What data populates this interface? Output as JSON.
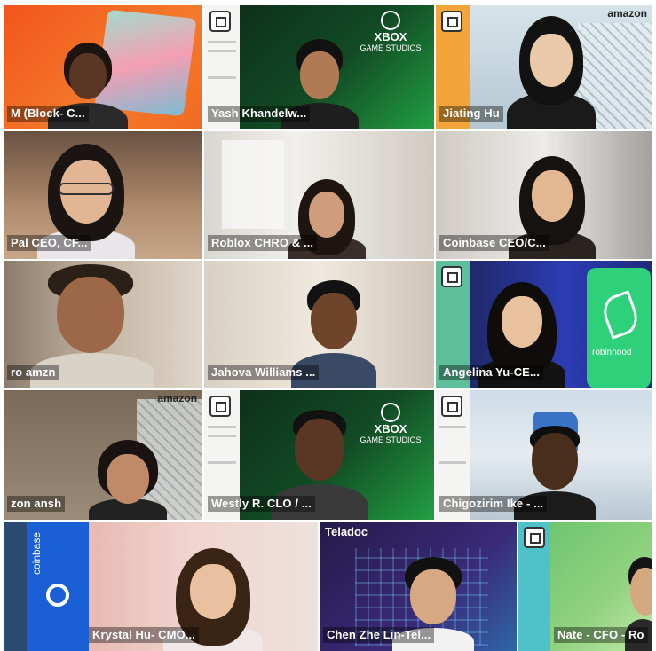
{
  "tiles": [
    {
      "name": "M (Block- C..."
    },
    {
      "name": "Yash Khandelw..."
    },
    {
      "name": "Jiating Hu"
    },
    {
      "name": "Pal CEO, CF..."
    },
    {
      "name": "Roblox CHRO & ..."
    },
    {
      "name": "Coinbase CEO/C..."
    },
    {
      "name": "ro  amzn"
    },
    {
      "name": "Jahova Williams ..."
    },
    {
      "name": "Angelina Yu-CE..."
    },
    {
      "name": "zon ansh"
    },
    {
      "name": "Westly R. CLO / ..."
    },
    {
      "name": "Chigozirim Ike - ..."
    },
    {
      "name": "Krystal Hu- CMO..."
    },
    {
      "name": "Chen Zhe Lin-Tel..."
    },
    {
      "name": "Nate - CFO - Ro"
    }
  ],
  "brands": {
    "xbox_line1": "XBOX",
    "xbox_line2": "GAME STUDIOS",
    "amazon": "amazon",
    "robinhood": "robinhood",
    "teladoc": "Teladoc",
    "coinbase": "coinbase"
  }
}
